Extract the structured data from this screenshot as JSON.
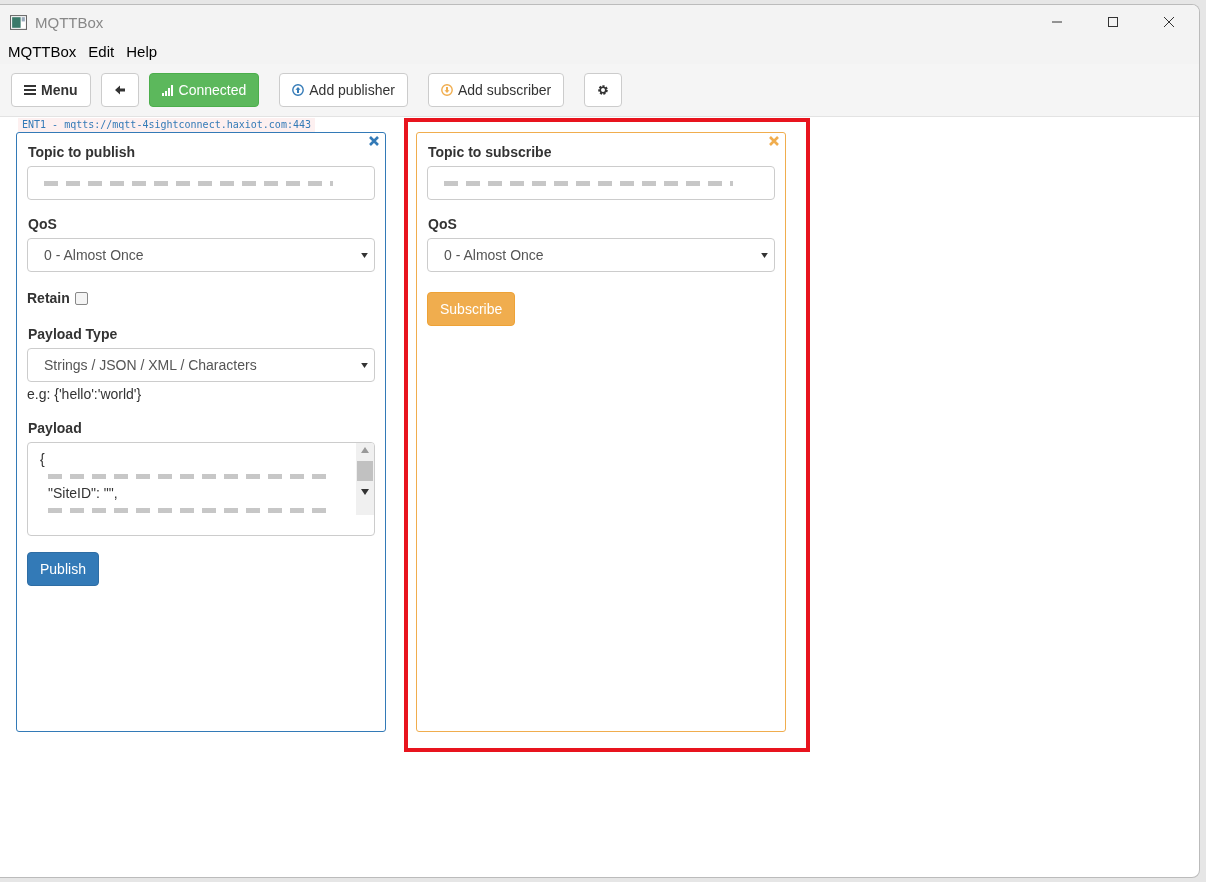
{
  "window": {
    "title": "MQTTBox"
  },
  "menu_bar": [
    "MQTTBox",
    "Edit",
    "Help"
  ],
  "toolbar": {
    "menu": "Menu",
    "connection": {
      "label": "Connected",
      "connected": true
    },
    "add_publisher": "Add publisher",
    "add_subscriber": "Add subscriber"
  },
  "connection_label": "ENT1 - mqtts://mqtt-4sightconnect.haxiot.com:443",
  "publisher": {
    "topic_label": "Topic to publish",
    "topic_redacted": true,
    "qos_label": "QoS",
    "qos": "0 - Almost Once",
    "retain_label": "Retain",
    "retain": false,
    "payload_type_label": "Payload Type",
    "payload_type": "Strings / JSON / XML / Characters",
    "hint": "e.g: {'hello':'world'}",
    "payload_label": "Payload",
    "payload_lines": [
      {
        "kind": "text",
        "text": "{"
      },
      {
        "kind": "redacted"
      },
      {
        "kind": "text",
        "text": "\"SiteID\": \"\","
      },
      {
        "kind": "redacted"
      }
    ],
    "button": "Publish"
  },
  "subscriber": {
    "topic_label": "Topic to subscribe",
    "topic_redacted": true,
    "qos_label": "QoS",
    "qos": "0 - Almost Once",
    "button": "Subscribe",
    "highlighted": true
  }
}
